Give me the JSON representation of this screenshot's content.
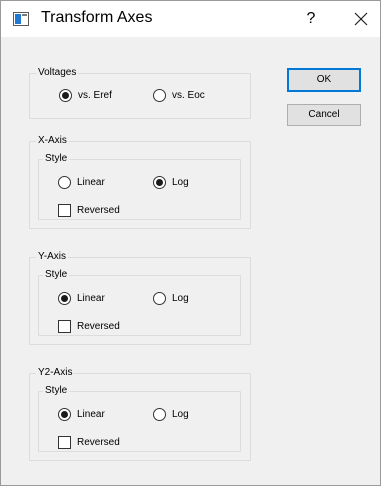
{
  "window": {
    "title": "Transform Axes",
    "help_label": "?"
  },
  "voltages": {
    "label": "Voltages",
    "options": [
      "vs. Eref",
      "vs. Eoc"
    ],
    "selected": "vs. Eref"
  },
  "x_axis": {
    "label": "X-Axis",
    "style_label": "Style",
    "options": [
      "Linear",
      "Log"
    ],
    "selected": "Log",
    "reversed_label": "Reversed",
    "reversed": false
  },
  "y_axis": {
    "label": "Y-Axis",
    "style_label": "Style",
    "options": [
      "Linear",
      "Log"
    ],
    "selected": "Linear",
    "reversed_label": "Reversed",
    "reversed": false
  },
  "y2_axis": {
    "label": "Y2-Axis",
    "style_label": "Style",
    "options": [
      "Linear",
      "Log"
    ],
    "selected": "Linear",
    "reversed_label": "Reversed",
    "reversed": false
  },
  "buttons": {
    "ok_label": "OK",
    "cancel_label": "Cancel"
  }
}
